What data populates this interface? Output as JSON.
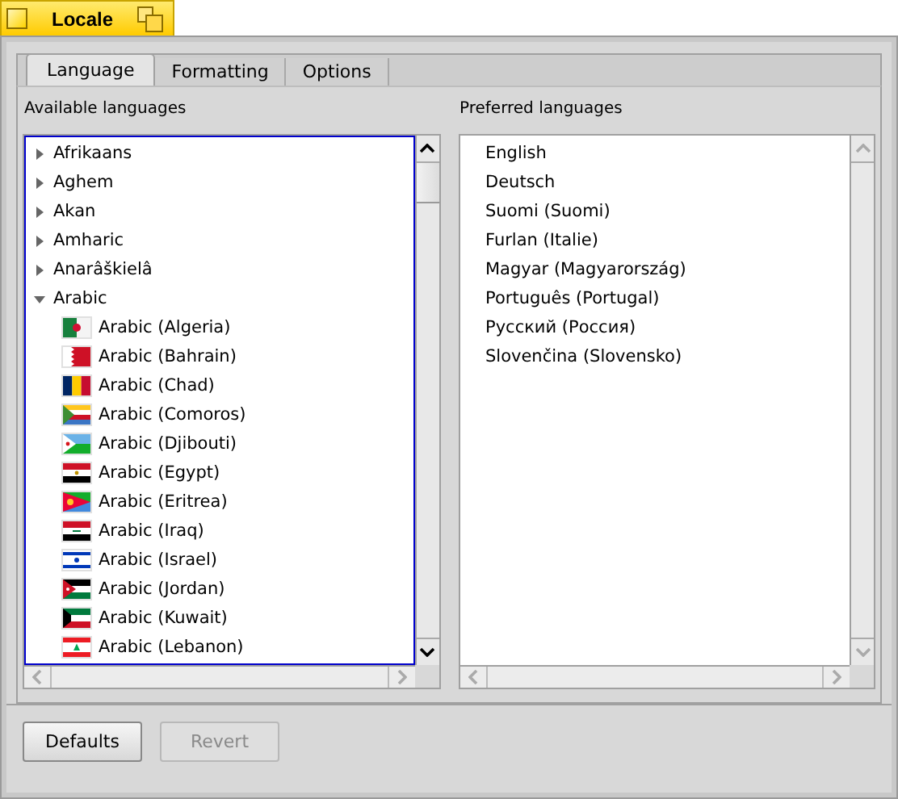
{
  "window": {
    "title": "Locale"
  },
  "tabs": [
    {
      "label": "Language",
      "selected": true
    },
    {
      "label": "Formatting",
      "selected": false
    },
    {
      "label": "Options",
      "selected": false
    }
  ],
  "available": {
    "label": "Available languages",
    "focused": true,
    "items": [
      {
        "label": "Afrikaans",
        "expanded": false,
        "selected": false
      },
      {
        "label": "Aghem",
        "expanded": false,
        "selected": false
      },
      {
        "label": "Akan",
        "expanded": false,
        "selected": false
      },
      {
        "label": "Amharic",
        "expanded": false,
        "selected": false
      },
      {
        "label": "Anarâškielâ",
        "expanded": false,
        "selected": false
      },
      {
        "label": "Arabic",
        "expanded": true,
        "selected": false,
        "children": [
          {
            "label": "Arabic (Algeria)",
            "selected": false
          },
          {
            "label": "Arabic (Bahrain)",
            "selected": false
          },
          {
            "label": "Arabic (Chad)",
            "selected": false
          },
          {
            "label": "Arabic (Comoros)",
            "selected": false
          },
          {
            "label": "Arabic (Djibouti)",
            "selected": false
          },
          {
            "label": "Arabic (Egypt)",
            "selected": false
          },
          {
            "label": "Arabic (Eritrea)",
            "selected": false
          },
          {
            "label": "Arabic (Iraq)",
            "selected": false
          },
          {
            "label": "Arabic (Israel)",
            "selected": false
          },
          {
            "label": "Arabic (Jordan)",
            "selected": false
          },
          {
            "label": "Arabic (Kuwait)",
            "selected": false
          },
          {
            "label": "Arabic (Lebanon)",
            "selected": false
          }
        ]
      }
    ]
  },
  "preferred": {
    "label": "Preferred languages",
    "focused": false,
    "items": [
      {
        "label": "English",
        "selected": false
      },
      {
        "label": "Deutsch",
        "selected": false
      },
      {
        "label": "Suomi (Suomi)",
        "selected": false
      },
      {
        "label": "Furlan (Italie)",
        "selected": false
      },
      {
        "label": "Magyar (Magyarország)",
        "selected": false
      },
      {
        "label": "Português (Portugal)",
        "selected": false
      },
      {
        "label": "Русский (Россия)",
        "selected": false
      },
      {
        "label": "Slovenčina (Slovensko)",
        "selected": false
      }
    ]
  },
  "buttons": [
    {
      "label": "Defaults",
      "disabled": false
    },
    {
      "label": "Revert",
      "disabled": true
    }
  ]
}
